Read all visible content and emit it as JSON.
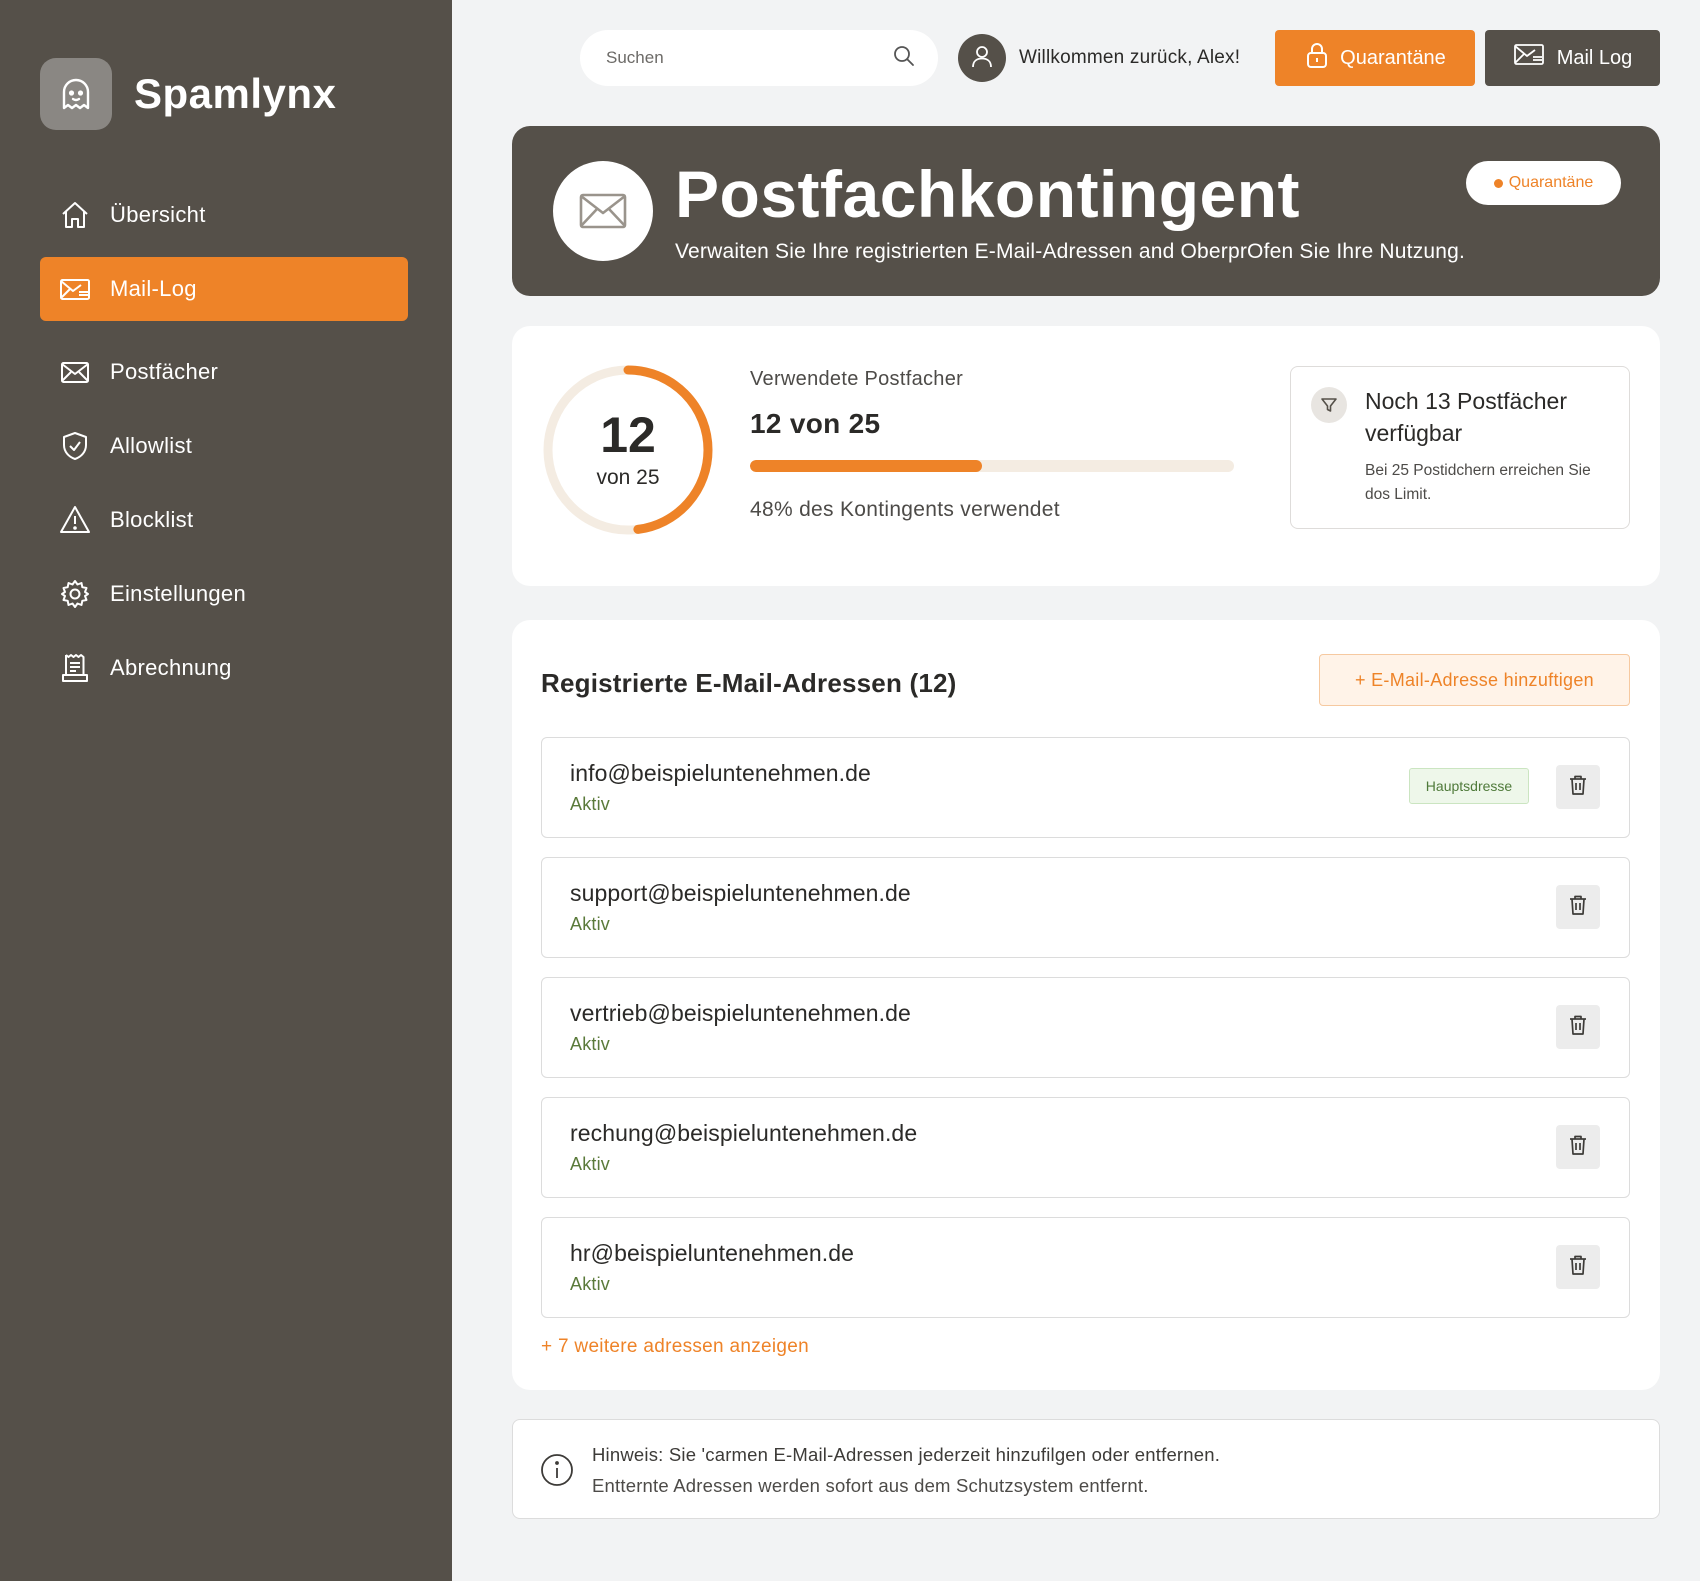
{
  "brand": {
    "name": "Spamlynx",
    "logo_icon": "ghost-icon"
  },
  "sidebar": {
    "items": [
      {
        "label": "Übersicht",
        "icon": "home-icon",
        "active": false
      },
      {
        "label": "Mail-Log",
        "icon": "mail-list-icon",
        "active": true
      },
      {
        "label": "Postfächer",
        "icon": "envelope-icon",
        "active": false
      },
      {
        "label": "Allowlist",
        "icon": "shield-check-icon",
        "active": false
      },
      {
        "label": "Blocklist",
        "icon": "warning-icon",
        "active": false
      },
      {
        "label": "Einstellungen",
        "icon": "gear-icon",
        "active": false
      },
      {
        "label": "Abrechnung",
        "icon": "receipt-icon",
        "active": false
      }
    ]
  },
  "topbar": {
    "search_placeholder": "Suchen",
    "welcome": "Willkommen zurück, Alex!",
    "quarantine_label": "Quarantäne",
    "maillog_label": "Mail Log"
  },
  "hero": {
    "title": "Postfachkontingent",
    "subtitle": "Verwaiten Sie Ihre registrierten E-Mail-Adressen and OberprOfen Sie Ihre Nutzung.",
    "badge": "Quarantäne"
  },
  "quota": {
    "used": "12",
    "of_label": "von 25",
    "label": "Verwendete Postfacher",
    "value": "12 von 25",
    "fraction": 0.48,
    "percent_text": "48% des Kontingents verwendet",
    "avail_title": "Noch 13 Postfächer verfügbar",
    "avail_text": "Bei 25 Postidchern erreichen Sie dos Limit."
  },
  "addresses": {
    "title": "Registrierte E-Mail-Adressen (12)",
    "add_label": "+ E-Mail-Adresse hinzuftigen",
    "rows": [
      {
        "email": "info@beispieluntenehmen.de",
        "status": "Aktiv",
        "badge": "Hauptsdresse"
      },
      {
        "email": "support@beispieluntenehmen.de",
        "status": "Aktiv",
        "badge": ""
      },
      {
        "email": "vertrieb@beispieluntenehmen.de",
        "status": "Aktiv",
        "badge": ""
      },
      {
        "email": "rechung@beispieluntenehmen.de",
        "status": "Aktiv",
        "badge": ""
      },
      {
        "email": "hr@beispieluntenehmen.de",
        "status": "Aktiv",
        "badge": ""
      }
    ],
    "more_label": "+ 7 weitere adressen anzeigen"
  },
  "note": {
    "line1": "Hinweis: Sie 'carmen E-Mail-Adressen jederzeit hinzufilgen oder entfernen.",
    "line2": "Entternte Adressen werden sofort aus dem Schutzsystem entfernt."
  },
  "colors": {
    "accent": "#ee8328",
    "dark": "#555049",
    "status_green": "#5a7a3a"
  }
}
